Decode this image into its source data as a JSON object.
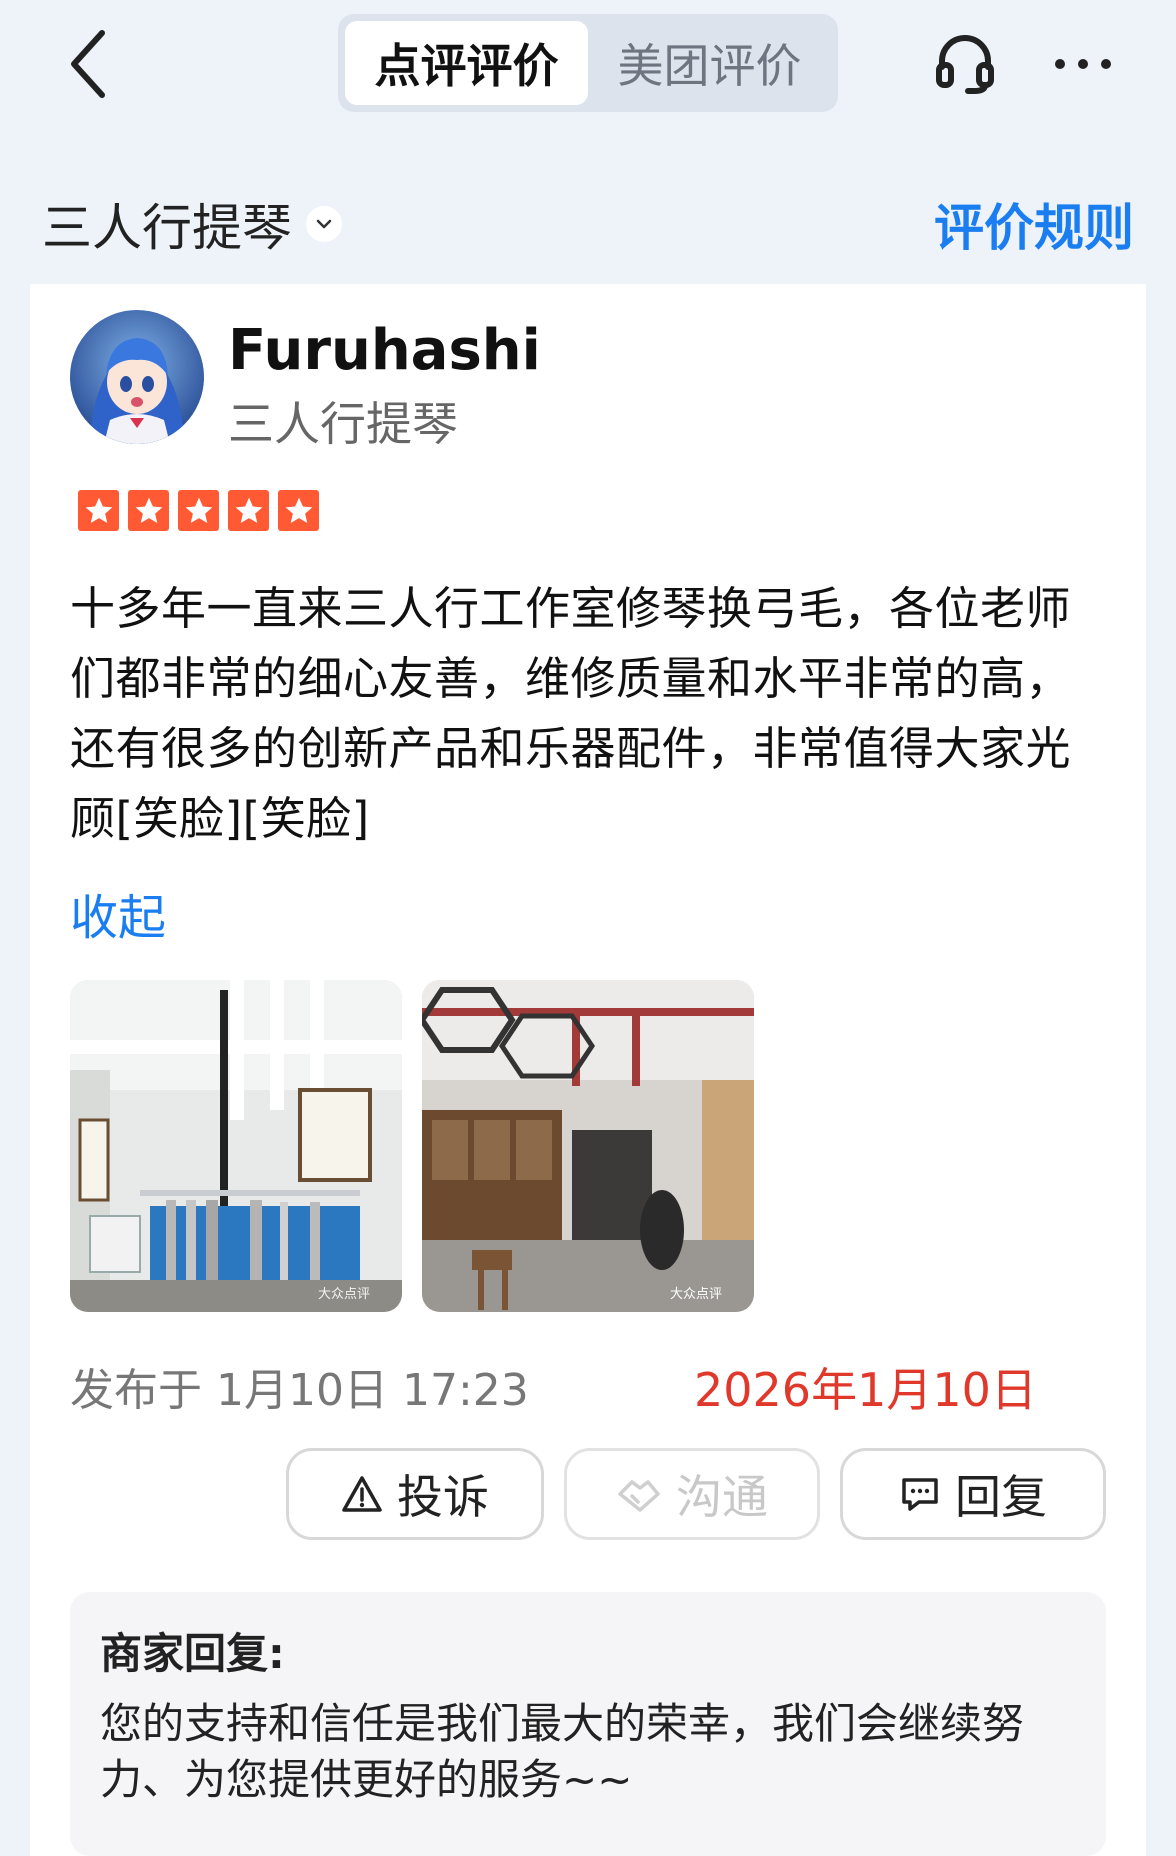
{
  "nav": {
    "tabs": [
      {
        "label": "点评评价",
        "active": true
      },
      {
        "label": "美团评价",
        "active": false
      }
    ],
    "icons": [
      "back-arrow-icon",
      "headset-icon",
      "more-icon"
    ]
  },
  "shop": {
    "name": "三人行提琴",
    "rules_label": "评价规则"
  },
  "review": {
    "user_name": "Furuhashi",
    "user_shop": "三人行提琴",
    "rating": 5,
    "text": "十多年一直来三人行工作室修琴换弓毛，各位老师们都非常的细心友善，维修质量和水平非常的高，还有很多的创新产品和乐器配件，非常值得大家光顾[笑脸][笑脸]",
    "collapse_label": "收起",
    "photos": [
      {
        "watermark": "大众点评"
      },
      {
        "watermark": "大众点评"
      }
    ],
    "post_time": "发布于 1月10日 17:23",
    "edit_date": "2026年1月10日"
  },
  "actions": {
    "complain": "投诉",
    "chat": "沟通",
    "reply": "回复"
  },
  "merchant_reply": {
    "title": "商家回复:",
    "text": "您的支持和信任是我们最大的荣幸，我们会继续努力、为您提供更好的服务~~"
  },
  "colors": {
    "accent_blue": "#1a7ef0",
    "star_orange": "#ff5a33",
    "date_red": "#e0392b",
    "page_bg": "#eef3fa"
  }
}
